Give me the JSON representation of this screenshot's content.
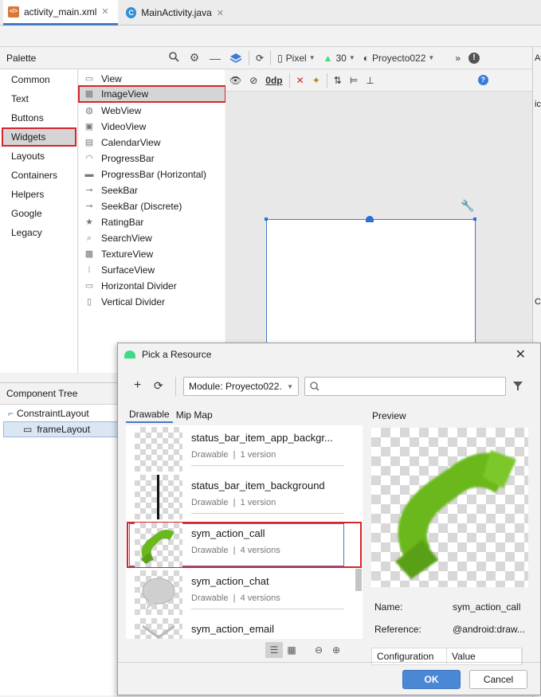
{
  "tabs": [
    {
      "label": "activity_main.xml",
      "icon": "xml-file-icon",
      "active": true
    },
    {
      "label": "MainActivity.java",
      "icon": "java-class-icon",
      "active": false
    }
  ],
  "palette": {
    "title": "Palette",
    "categories": [
      "Common",
      "Text",
      "Buttons",
      "Widgets",
      "Layouts",
      "Containers",
      "Helpers",
      "Google",
      "Legacy"
    ],
    "selected_category": "Widgets",
    "widgets": [
      "View",
      "ImageView",
      "WebView",
      "VideoView",
      "CalendarView",
      "ProgressBar",
      "ProgressBar (Horizontal)",
      "SeekBar",
      "SeekBar (Discrete)",
      "RatingBar",
      "SearchView",
      "TextureView",
      "SurfaceView",
      "Horizontal Divider",
      "Vertical Divider"
    ],
    "selected_widget": "ImageView"
  },
  "design_toolbar": {
    "device": "Pixel",
    "api": "30",
    "theme": "Proyecto022",
    "margin": "0dp"
  },
  "attributes_strip": {
    "header": "At",
    "row1": "ic",
    "row2": "C"
  },
  "component_tree": {
    "title": "Component Tree",
    "items": [
      "ConstraintLayout",
      "frameLayout"
    ]
  },
  "dialog": {
    "title": "Pick a Resource",
    "module": "Module: Proyecto022.",
    "tabs": [
      "Drawable",
      "Mip Map"
    ],
    "resources": [
      {
        "name": "status_bar_item_app_backgr...",
        "type": "Drawable",
        "versions": "1 version"
      },
      {
        "name": "status_bar_item_background",
        "type": "Drawable",
        "versions": "1 version"
      },
      {
        "name": "sym_action_call",
        "type": "Drawable",
        "versions": "4 versions"
      },
      {
        "name": "sym_action_chat",
        "type": "Drawable",
        "versions": "4 versions"
      },
      {
        "name": "sym_action_email",
        "type": "",
        "versions": ""
      }
    ],
    "preview_label": "Preview",
    "name_label": "Name:",
    "name_value": "sym_action_call",
    "reference_label": "Reference:",
    "reference_value": "@android:draw...",
    "table_headers": [
      "Configuration",
      "Value"
    ],
    "ok_label": "OK",
    "cancel_label": "Cancel"
  },
  "colors": {
    "accent": "#4a78c2",
    "highlight": "#d8242a",
    "android_green": "#3ddc84",
    "phone_green": "#6bb81e"
  }
}
